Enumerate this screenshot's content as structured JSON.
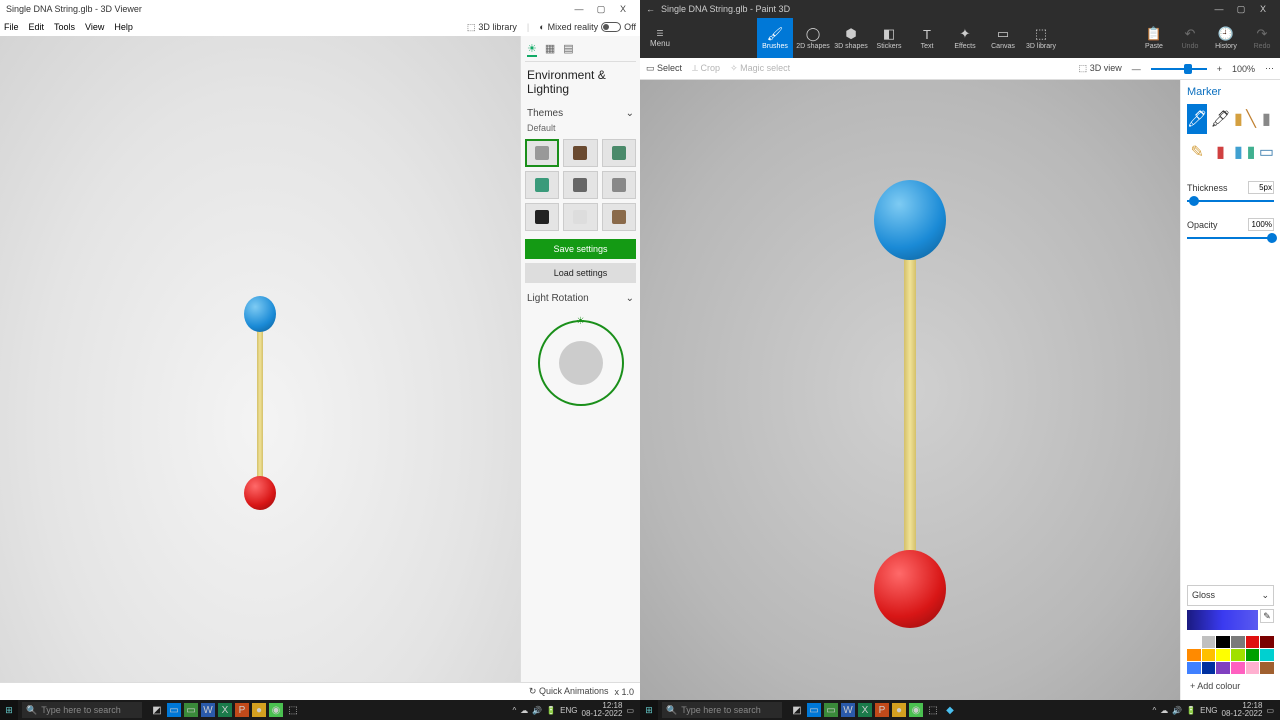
{
  "viewer": {
    "title": "Single DNA String.glb - 3D Viewer",
    "menu": [
      "File",
      "Edit",
      "Tools",
      "View",
      "Help"
    ],
    "lib": "3D library",
    "mr": "Mixed reality",
    "mr_state": "Off",
    "panel_title": "Environment & Lighting",
    "themes_h": "Themes",
    "theme_default": "Default",
    "save": "Save settings",
    "load": "Load settings",
    "light_rot": "Light Rotation",
    "quick_anim": "Quick Animations",
    "speed": "x 1.0"
  },
  "paint": {
    "title": "Single DNA String.glb - Paint 3D",
    "menu": "Menu",
    "tools": [
      "Brushes",
      "2D shapes",
      "3D shapes",
      "Stickers",
      "Text",
      "Effects",
      "Canvas",
      "3D library"
    ],
    "paste": "Paste",
    "undo": "Undo",
    "history": "History",
    "redo": "Redo",
    "select": "Select",
    "crop": "Crop",
    "magic": "Magic select",
    "view3d": "3D view",
    "zoom": "100%",
    "panel_h": "Marker",
    "thickness": "Thickness",
    "thickness_v": "5px",
    "opacity": "Opacity",
    "opacity_v": "100%",
    "finish": "Gloss",
    "addcol": "+  Add colour"
  },
  "palette": [
    "#ffffff",
    "#c0c0c0",
    "#000000",
    "#7a7a7a",
    "#e01010",
    "#7a0000",
    "#ff8a00",
    "#ffc000",
    "#ffff00",
    "#a0e000",
    "#00a000",
    "#00d0d0",
    "#4080ff",
    "#0030a0",
    "#8040c0",
    "#ff60c0",
    "#ffb0d0",
    "#a06030"
  ],
  "taskbar": {
    "search": "Type here to search",
    "time": "12:18",
    "date": "08-12-2022",
    "lang": "ENG"
  }
}
